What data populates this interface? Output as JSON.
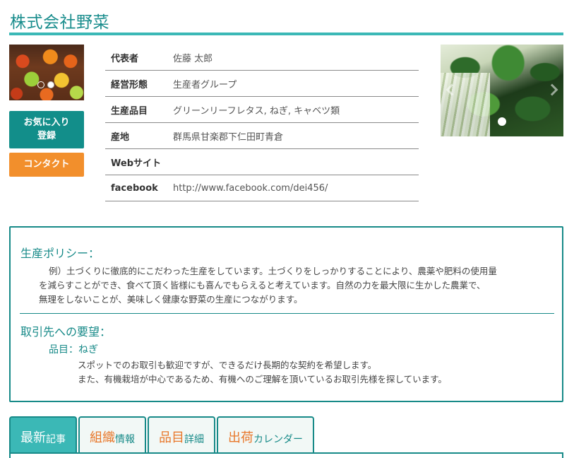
{
  "company": {
    "name": "株式会社野菜"
  },
  "buttons": {
    "favorite_line1": "お気に入り",
    "favorite_line2": "登録",
    "contact": "コンタクト"
  },
  "info": [
    {
      "label": "代表者",
      "value": "佐藤 太郎"
    },
    {
      "label": "経営形態",
      "value": "生産者グループ"
    },
    {
      "label": "生産品目",
      "value": "グリーンリーフレタス, ねぎ, キャベツ類"
    },
    {
      "label": "産地",
      "value": "群馬県甘楽郡下仁田町青倉"
    },
    {
      "label": "Webサイト",
      "value": ""
    },
    {
      "label": "facebook",
      "value": "http://www.facebook.com/dei456/"
    }
  ],
  "policy": {
    "heading": "生産ポリシー：",
    "line1": "例）土づくりに徹底的にこだわった生産をしています。土づくりをしっかりすることにより、農薬や肥料の使用量",
    "line2": "を減らすことができ、食べて頂く皆様にも喜んでもらえると考えています。自然の力を最大限に生かした農業で、",
    "line3": "無理をしないことが、美味しく健康な野菜の生産につながります。"
  },
  "request": {
    "heading": "取引先への要望：",
    "item_title": "品目：ねぎ",
    "line1": "スポットでのお取引も歓迎ですが、できるだけ長期的な契約を希望します。",
    "line2": "また、有機栽培が中心であるため、有機へのご理解を頂いているお取引先様を探しています。"
  },
  "tabs": [
    {
      "big": "最新",
      "small": "記事",
      "active": true
    },
    {
      "big": "組織",
      "small": "情報",
      "active": false
    },
    {
      "big": "品目",
      "small": "詳細",
      "active": false
    },
    {
      "big": "出荷",
      "small": "カレンダー",
      "active": false
    }
  ],
  "colors": {
    "accent": "#178a88",
    "tab_active": "#3bb8b6",
    "orange": "#f28f2c"
  },
  "icons": {
    "carousel_dot": "dot-indicator",
    "carousel_prev": "chevron-left-icon",
    "carousel_next": "chevron-right-icon"
  }
}
